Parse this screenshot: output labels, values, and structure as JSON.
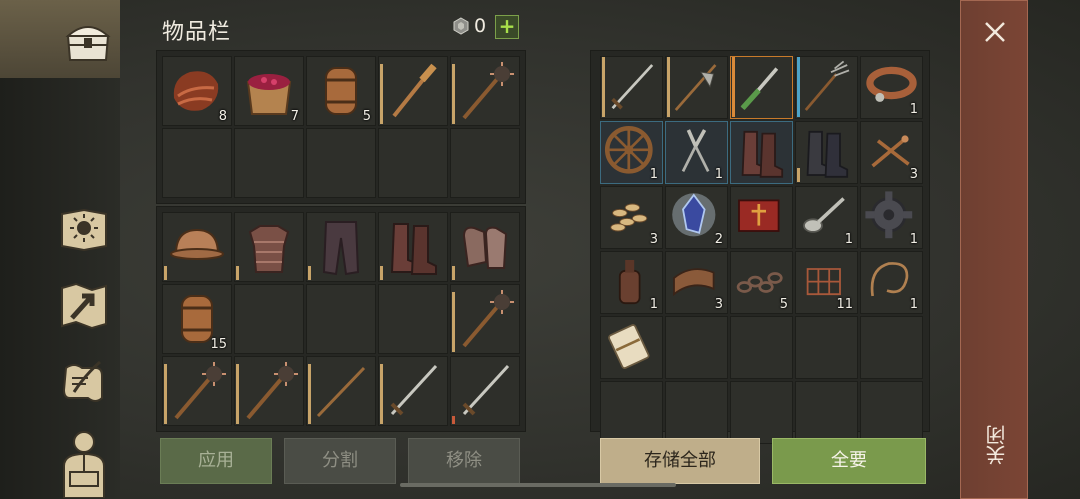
{
  "inventory": {
    "title": "物品栏",
    "gem_count": "0",
    "plus_label": "+"
  },
  "top_grid": [
    {
      "name": "meat-item",
      "qty": "8"
    },
    {
      "name": "berry-bucket-item",
      "qty": "7"
    },
    {
      "name": "barrel-item",
      "qty": "5"
    },
    {
      "name": "club-item",
      "qty": ""
    },
    {
      "name": "mace-item",
      "qty": ""
    },
    {
      "name": "empty",
      "qty": ""
    },
    {
      "name": "empty",
      "qty": ""
    },
    {
      "name": "empty",
      "qty": ""
    },
    {
      "name": "empty",
      "qty": ""
    },
    {
      "name": "empty",
      "qty": ""
    }
  ],
  "equip_grid": [
    {
      "name": "helmet-item",
      "qty": ""
    },
    {
      "name": "chainmail-item",
      "qty": ""
    },
    {
      "name": "pants-item",
      "qty": ""
    },
    {
      "name": "boots-item",
      "qty": ""
    },
    {
      "name": "gloves-item",
      "qty": ""
    },
    {
      "name": "barrel-item",
      "qty": "15"
    },
    {
      "name": "empty",
      "qty": ""
    },
    {
      "name": "empty",
      "qty": ""
    },
    {
      "name": "empty",
      "qty": ""
    },
    {
      "name": "mace-item",
      "qty": ""
    },
    {
      "name": "mace-item",
      "qty": ""
    },
    {
      "name": "mace-item",
      "qty": ""
    },
    {
      "name": "spear-item",
      "qty": ""
    },
    {
      "name": "sword-item",
      "qty": ""
    },
    {
      "name": "sword-item",
      "qty": ""
    }
  ],
  "storage_grid": [
    {
      "name": "sword-item",
      "qty": ""
    },
    {
      "name": "halberd-item",
      "qty": ""
    },
    {
      "name": "green-dagger-item",
      "qty": ""
    },
    {
      "name": "pitchfork-item",
      "qty": ""
    },
    {
      "name": "collar-item",
      "qty": "1"
    },
    {
      "name": "wheel-item",
      "qty": "1"
    },
    {
      "name": "pliers-item",
      "qty": "1"
    },
    {
      "name": "boots-item",
      "qty": ""
    },
    {
      "name": "dark-boots-item",
      "qty": ""
    },
    {
      "name": "nails-item",
      "qty": "3"
    },
    {
      "name": "seeds-item",
      "qty": "3"
    },
    {
      "name": "crystal-item",
      "qty": "2"
    },
    {
      "name": "book-item",
      "qty": ""
    },
    {
      "name": "spoon-item",
      "qty": "1"
    },
    {
      "name": "gear-item",
      "qty": "1"
    },
    {
      "name": "bottle-item",
      "qty": "1"
    },
    {
      "name": "leather-item",
      "qty": "3"
    },
    {
      "name": "chain-item",
      "qty": "5"
    },
    {
      "name": "net-item",
      "qty": "11"
    },
    {
      "name": "rope-item",
      "qty": "1"
    },
    {
      "name": "scroll-item",
      "qty": ""
    },
    {
      "name": "empty",
      "qty": ""
    },
    {
      "name": "empty",
      "qty": ""
    },
    {
      "name": "empty",
      "qty": ""
    },
    {
      "name": "empty",
      "qty": ""
    },
    {
      "name": "empty",
      "qty": ""
    },
    {
      "name": "empty",
      "qty": ""
    },
    {
      "name": "empty",
      "qty": ""
    },
    {
      "name": "empty",
      "qty": ""
    },
    {
      "name": "empty",
      "qty": ""
    }
  ],
  "buttons": {
    "apply": "应用",
    "split": "分割",
    "remove": "移除",
    "store_all": "存储全部",
    "take_all": "全要"
  },
  "close": {
    "label": "关闭"
  },
  "colors": {
    "accent_green": "#7a9a4c",
    "button_tan": "#bfae8a",
    "close_bar": "#7b4535"
  }
}
